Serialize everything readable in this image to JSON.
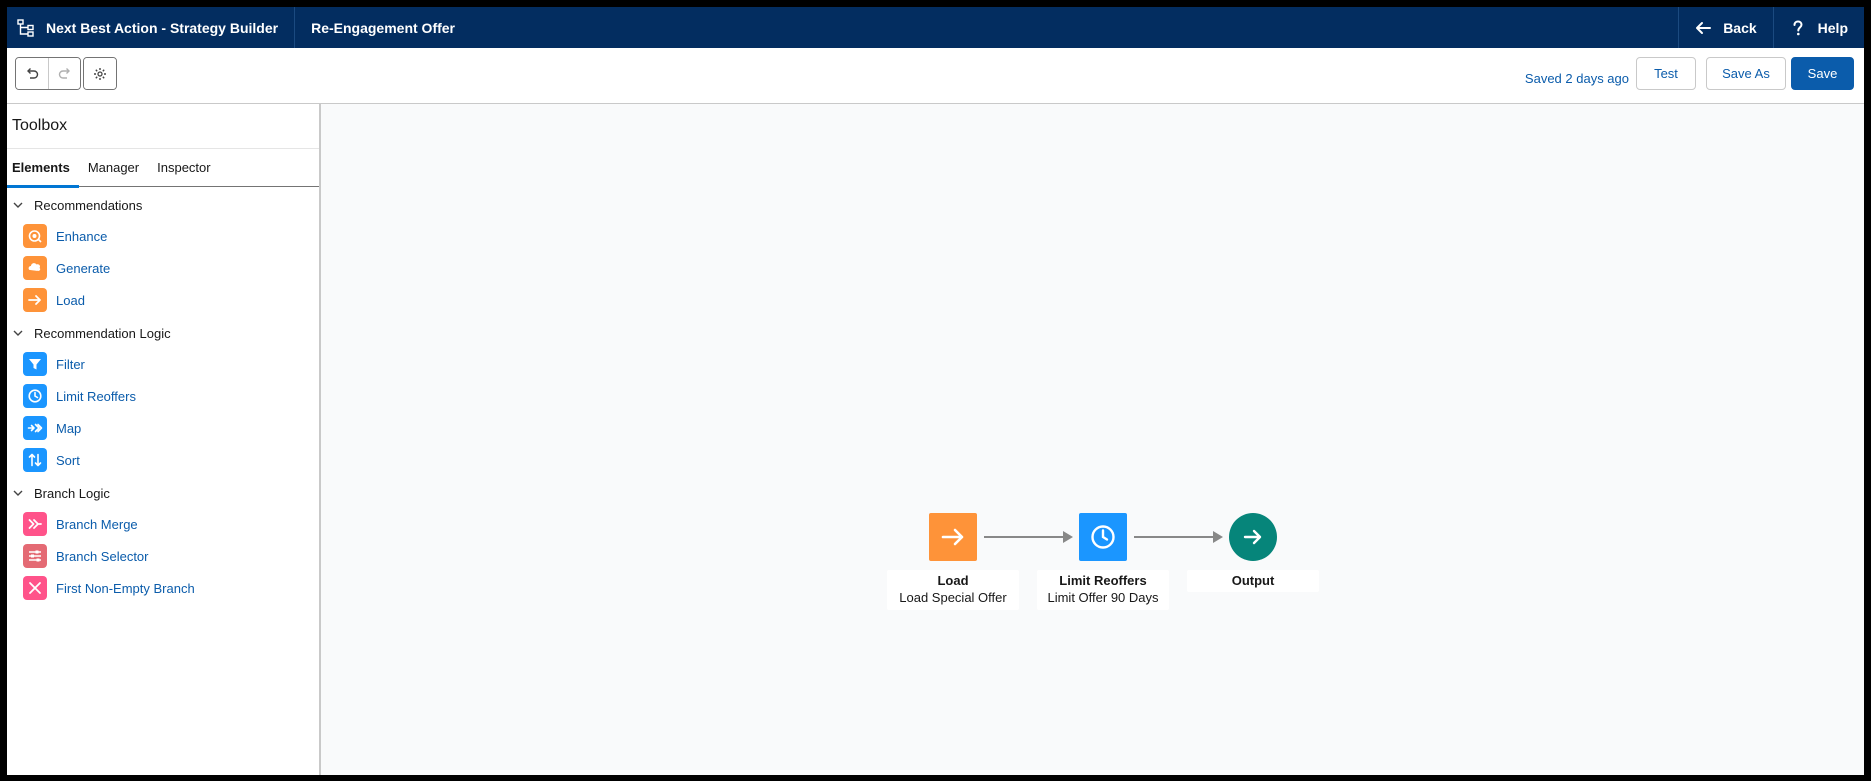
{
  "header": {
    "app_title": "Next Best Action - Strategy Builder",
    "tab_title": "Re-Engagement Offer",
    "back_label": "Back",
    "help_label": "Help"
  },
  "toolbar": {
    "saved_status": "Saved 2 days ago",
    "test_label": "Test",
    "save_as_label": "Save As",
    "save_label": "Save"
  },
  "sidebar": {
    "title": "Toolbox",
    "tabs": [
      {
        "label": "Elements",
        "active": true
      },
      {
        "label": "Manager",
        "active": false
      },
      {
        "label": "Inspector",
        "active": false
      }
    ],
    "sections": [
      {
        "label": "Recommendations",
        "items": [
          {
            "label": "Enhance",
            "icon": "enhance-icon",
            "color": "#fe9339"
          },
          {
            "label": "Generate",
            "icon": "generate-icon",
            "color": "#fe9339"
          },
          {
            "label": "Load",
            "icon": "arrow-right-icon",
            "color": "#fe9339"
          }
        ]
      },
      {
        "label": "Recommendation Logic",
        "items": [
          {
            "label": "Filter",
            "icon": "filter-icon",
            "color": "#1b96ff"
          },
          {
            "label": "Limit Reoffers",
            "icon": "clock-icon",
            "color": "#1b96ff"
          },
          {
            "label": "Map",
            "icon": "map-icon",
            "color": "#1b96ff"
          },
          {
            "label": "Sort",
            "icon": "sort-icon",
            "color": "#1b96ff"
          }
        ]
      },
      {
        "label": "Branch Logic",
        "items": [
          {
            "label": "Branch Merge",
            "icon": "branch-merge-icon",
            "color": "#ff538a"
          },
          {
            "label": "Branch Selector",
            "icon": "branch-selector-icon",
            "color": "#e46a74"
          },
          {
            "label": "First Non-Empty Branch",
            "icon": "first-non-empty-icon",
            "color": "#ff538a"
          }
        ]
      }
    ]
  },
  "canvas": {
    "nodes": [
      {
        "title": "Load",
        "subtitle": "Load Special Offer",
        "icon": "arrow-right-icon",
        "color": "#fe9339"
      },
      {
        "title": "Limit Reoffers",
        "subtitle": "Limit Offer 90 Days",
        "icon": "clock-icon",
        "color": "#1b96ff"
      },
      {
        "title": "Output",
        "subtitle": "",
        "icon": "arrow-right-icon",
        "color": "#06857a"
      }
    ]
  }
}
